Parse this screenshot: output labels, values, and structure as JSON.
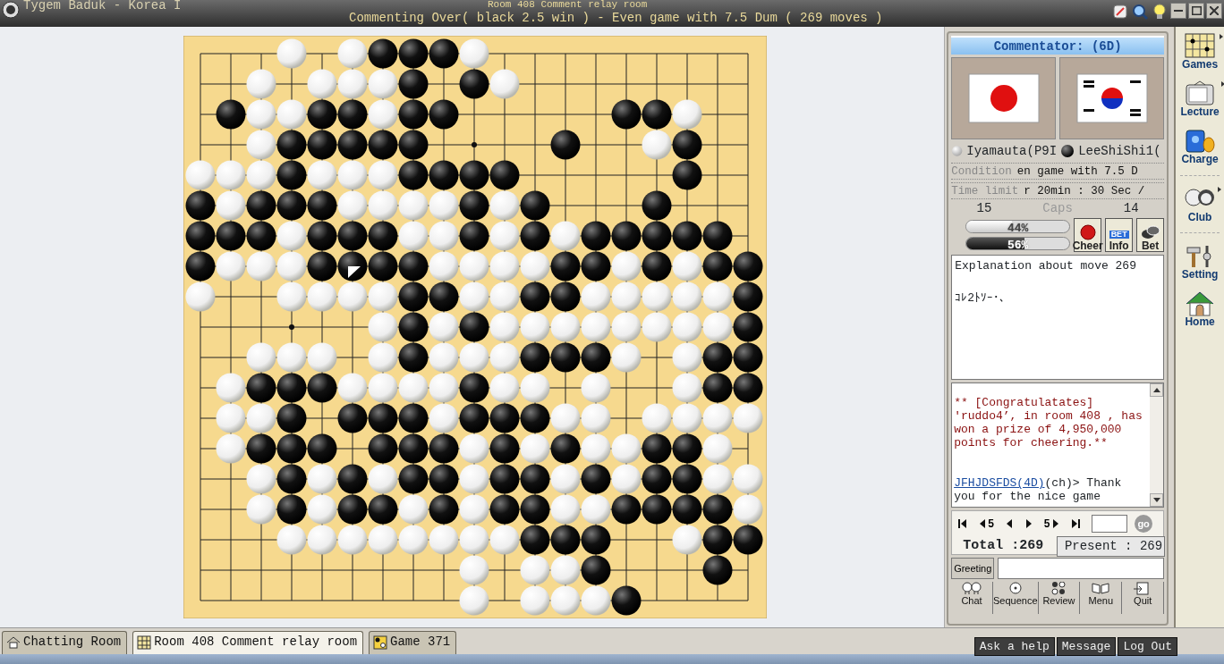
{
  "window": {
    "title": "Tygem Baduk - Korea I",
    "room": "Room 408 Comment relay room",
    "subtitle": "Commenting Over( black 2.5 win ) - Even game with 7.5 Dum  ( 269 moves )"
  },
  "board": {
    "rows": [
      [
        {
          "kind": "empty"
        },
        {
          "kind": "empty"
        },
        {
          "kind": "empty"
        },
        {
          "kind": "white"
        },
        {
          "kind": "empty"
        },
        {
          "kind": "white"
        },
        {
          "kind": "black"
        },
        {
          "kind": "black"
        },
        {
          "kind": "black"
        },
        {
          "kind": "white"
        },
        {
          "kind": "empty"
        },
        {
          "kind": "empty"
        },
        {
          "kind": "empty"
        },
        {
          "kind": "empty"
        },
        {
          "kind": "empty"
        },
        {
          "kind": "empty"
        },
        {
          "kind": "empty"
        },
        {
          "kind": "empty"
        },
        {
          "kind": "empty"
        }
      ],
      [
        {
          "kind": "empty"
        },
        {
          "kind": "empty"
        },
        {
          "kind": "white"
        },
        {
          "kind": "empty"
        },
        {
          "kind": "white"
        },
        {
          "kind": "white"
        },
        {
          "kind": "white"
        },
        {
          "kind": "black"
        },
        {
          "kind": "empty"
        },
        {
          "kind": "black"
        },
        {
          "kind": "white"
        },
        {
          "kind": "empty"
        },
        {
          "kind": "empty"
        },
        {
          "kind": "empty"
        },
        {
          "kind": "empty"
        },
        {
          "kind": "empty"
        },
        {
          "kind": "empty"
        },
        {
          "kind": "empty"
        },
        {
          "kind": "empty"
        }
      ],
      [
        {
          "kind": "empty"
        },
        {
          "kind": "black"
        },
        {
          "kind": "white"
        },
        {
          "kind": "white"
        },
        {
          "kind": "black"
        },
        {
          "kind": "black"
        },
        {
          "kind": "white"
        },
        {
          "kind": "black"
        },
        {
          "kind": "black"
        },
        {
          "kind": "empty"
        },
        {
          "kind": "empty"
        },
        {
          "kind": "empty"
        },
        {
          "kind": "empty"
        },
        {
          "kind": "empty"
        },
        {
          "kind": "black"
        },
        {
          "kind": "black"
        },
        {
          "kind": "white"
        },
        {
          "kind": "empty"
        },
        {
          "kind": "empty"
        }
      ],
      [
        {
          "kind": "empty"
        },
        {
          "kind": "empty"
        },
        {
          "kind": "white"
        },
        {
          "kind": "black"
        },
        {
          "kind": "black"
        },
        {
          "kind": "black"
        },
        {
          "kind": "black"
        },
        {
          "kind": "black"
        },
        {
          "kind": "empty"
        },
        {
          "kind": "empty"
        },
        {
          "kind": "empty"
        },
        {
          "kind": "empty"
        },
        {
          "kind": "black"
        },
        {
          "kind": "empty"
        },
        {
          "kind": "empty"
        },
        {
          "kind": "white"
        },
        {
          "kind": "black"
        },
        {
          "kind": "empty"
        },
        {
          "kind": "empty"
        }
      ],
      [
        {
          "kind": "white"
        },
        {
          "kind": "white"
        },
        {
          "kind": "white"
        },
        {
          "kind": "black"
        },
        {
          "kind": "white"
        },
        {
          "kind": "white"
        },
        {
          "kind": "white"
        },
        {
          "kind": "black"
        },
        {
          "kind": "black"
        },
        {
          "kind": "black"
        },
        {
          "kind": "black"
        },
        {
          "kind": "empty"
        },
        {
          "kind": "empty"
        },
        {
          "kind": "empty"
        },
        {
          "kind": "empty"
        },
        {
          "kind": "empty"
        },
        {
          "kind": "black"
        },
        {
          "kind": "empty"
        },
        {
          "kind": "empty"
        }
      ],
      [
        {
          "kind": "black"
        },
        {
          "kind": "white"
        },
        {
          "kind": "black"
        },
        {
          "kind": "black"
        },
        {
          "kind": "black"
        },
        {
          "kind": "white"
        },
        {
          "kind": "white"
        },
        {
          "kind": "white"
        },
        {
          "kind": "white"
        },
        {
          "kind": "black"
        },
        {
          "kind": "white"
        },
        {
          "kind": "black"
        },
        {
          "kind": "empty"
        },
        {
          "kind": "empty"
        },
        {
          "kind": "empty"
        },
        {
          "kind": "black"
        },
        {
          "kind": "empty"
        },
        {
          "kind": "empty"
        },
        {
          "kind": "empty"
        }
      ],
      [
        {
          "kind": "black"
        },
        {
          "kind": "black"
        },
        {
          "kind": "black"
        },
        {
          "kind": "white"
        },
        {
          "kind": "black"
        },
        {
          "kind": "black"
        },
        {
          "kind": "black"
        },
        {
          "kind": "white"
        },
        {
          "kind": "white"
        },
        {
          "kind": "black"
        },
        {
          "kind": "white"
        },
        {
          "kind": "black"
        },
        {
          "kind": "white"
        },
        {
          "kind": "black"
        },
        {
          "kind": "black"
        },
        {
          "kind": "black"
        },
        {
          "kind": "black"
        },
        {
          "kind": "black"
        },
        {
          "kind": "empty"
        }
      ],
      [
        {
          "kind": "black"
        },
        {
          "kind": "white"
        },
        {
          "kind": "white"
        },
        {
          "kind": "white"
        },
        {
          "kind": "black"
        },
        {
          "kind": "black",
          "last_move": true
        },
        {
          "kind": "black"
        },
        {
          "kind": "black"
        },
        {
          "kind": "white"
        },
        {
          "kind": "white"
        },
        {
          "kind": "white"
        },
        {
          "kind": "white"
        },
        {
          "kind": "black"
        },
        {
          "kind": "black"
        },
        {
          "kind": "white"
        },
        {
          "kind": "black"
        },
        {
          "kind": "white"
        },
        {
          "kind": "black"
        },
        {
          "kind": "black"
        }
      ],
      [
        {
          "kind": "white"
        },
        {
          "kind": "empty"
        },
        {
          "kind": "empty"
        },
        {
          "kind": "white"
        },
        {
          "kind": "white"
        },
        {
          "kind": "white"
        },
        {
          "kind": "white"
        },
        {
          "kind": "black"
        },
        {
          "kind": "black"
        },
        {
          "kind": "white"
        },
        {
          "kind": "white"
        },
        {
          "kind": "black"
        },
        {
          "kind": "black"
        },
        {
          "kind": "white"
        },
        {
          "kind": "white"
        },
        {
          "kind": "white"
        },
        {
          "kind": "white"
        },
        {
          "kind": "white"
        },
        {
          "kind": "black"
        }
      ],
      [
        {
          "kind": "empty"
        },
        {
          "kind": "empty"
        },
        {
          "kind": "empty"
        },
        {
          "kind": "empty"
        },
        {
          "kind": "empty"
        },
        {
          "kind": "empty"
        },
        {
          "kind": "white"
        },
        {
          "kind": "black"
        },
        {
          "kind": "white"
        },
        {
          "kind": "black"
        },
        {
          "kind": "white"
        },
        {
          "kind": "white"
        },
        {
          "kind": "white"
        },
        {
          "kind": "white"
        },
        {
          "kind": "white"
        },
        {
          "kind": "white"
        },
        {
          "kind": "white"
        },
        {
          "kind": "white"
        },
        {
          "kind": "black"
        }
      ],
      [
        {
          "kind": "empty"
        },
        {
          "kind": "empty"
        },
        {
          "kind": "white"
        },
        {
          "kind": "white"
        },
        {
          "kind": "white"
        },
        {
          "kind": "empty"
        },
        {
          "kind": "white"
        },
        {
          "kind": "black"
        },
        {
          "kind": "white"
        },
        {
          "kind": "white"
        },
        {
          "kind": "white"
        },
        {
          "kind": "black"
        },
        {
          "kind": "black"
        },
        {
          "kind": "black"
        },
        {
          "kind": "white"
        },
        {
          "kind": "empty"
        },
        {
          "kind": "white"
        },
        {
          "kind": "black"
        },
        {
          "kind": "black"
        }
      ],
      [
        {
          "kind": "empty"
        },
        {
          "kind": "white"
        },
        {
          "kind": "black"
        },
        {
          "kind": "black"
        },
        {
          "kind": "black"
        },
        {
          "kind": "white"
        },
        {
          "kind": "white"
        },
        {
          "kind": "white"
        },
        {
          "kind": "white"
        },
        {
          "kind": "black"
        },
        {
          "kind": "white"
        },
        {
          "kind": "white"
        },
        {
          "kind": "empty"
        },
        {
          "kind": "white"
        },
        {
          "kind": "empty"
        },
        {
          "kind": "empty"
        },
        {
          "kind": "white"
        },
        {
          "kind": "black"
        },
        {
          "kind": "black"
        }
      ],
      [
        {
          "kind": "empty"
        },
        {
          "kind": "white"
        },
        {
          "kind": "white"
        },
        {
          "kind": "black"
        },
        {
          "kind": "empty"
        },
        {
          "kind": "black"
        },
        {
          "kind": "black"
        },
        {
          "kind": "black"
        },
        {
          "kind": "white"
        },
        {
          "kind": "black"
        },
        {
          "kind": "black"
        },
        {
          "kind": "black"
        },
        {
          "kind": "white"
        },
        {
          "kind": "white"
        },
        {
          "kind": "empty"
        },
        {
          "kind": "white"
        },
        {
          "kind": "white"
        },
        {
          "kind": "white"
        },
        {
          "kind": "white"
        }
      ],
      [
        {
          "kind": "empty"
        },
        {
          "kind": "white"
        },
        {
          "kind": "black"
        },
        {
          "kind": "black"
        },
        {
          "kind": "black"
        },
        {
          "kind": "empty"
        },
        {
          "kind": "black"
        },
        {
          "kind": "black"
        },
        {
          "kind": "black"
        },
        {
          "kind": "white"
        },
        {
          "kind": "black"
        },
        {
          "kind": "white"
        },
        {
          "kind": "black"
        },
        {
          "kind": "white"
        },
        {
          "kind": "white"
        },
        {
          "kind": "black"
        },
        {
          "kind": "black"
        },
        {
          "kind": "white"
        },
        {
          "kind": "empty"
        }
      ],
      [
        {
          "kind": "empty"
        },
        {
          "kind": "empty"
        },
        {
          "kind": "white"
        },
        {
          "kind": "black"
        },
        {
          "kind": "white"
        },
        {
          "kind": "black"
        },
        {
          "kind": "white"
        },
        {
          "kind": "black"
        },
        {
          "kind": "black"
        },
        {
          "kind": "white"
        },
        {
          "kind": "black"
        },
        {
          "kind": "black"
        },
        {
          "kind": "white"
        },
        {
          "kind": "black"
        },
        {
          "kind": "white"
        },
        {
          "kind": "black"
        },
        {
          "kind": "black"
        },
        {
          "kind": "white"
        },
        {
          "kind": "white"
        }
      ],
      [
        {
          "kind": "empty"
        },
        {
          "kind": "empty"
        },
        {
          "kind": "white"
        },
        {
          "kind": "black"
        },
        {
          "kind": "white"
        },
        {
          "kind": "black"
        },
        {
          "kind": "black"
        },
        {
          "kind": "white"
        },
        {
          "kind": "black"
        },
        {
          "kind": "white"
        },
        {
          "kind": "black"
        },
        {
          "kind": "black"
        },
        {
          "kind": "white"
        },
        {
          "kind": "white"
        },
        {
          "kind": "black"
        },
        {
          "kind": "black"
        },
        {
          "kind": "black"
        },
        {
          "kind": "black"
        },
        {
          "kind": "white"
        }
      ],
      [
        {
          "kind": "empty"
        },
        {
          "kind": "empty"
        },
        {
          "kind": "empty"
        },
        {
          "kind": "white"
        },
        {
          "kind": "white"
        },
        {
          "kind": "white"
        },
        {
          "kind": "white"
        },
        {
          "kind": "white"
        },
        {
          "kind": "white"
        },
        {
          "kind": "white"
        },
        {
          "kind": "white"
        },
        {
          "kind": "black"
        },
        {
          "kind": "black"
        },
        {
          "kind": "black"
        },
        {
          "kind": "empty"
        },
        {
          "kind": "empty"
        },
        {
          "kind": "white"
        },
        {
          "kind": "black"
        },
        {
          "kind": "black"
        }
      ],
      [
        {
          "kind": "empty"
        },
        {
          "kind": "empty"
        },
        {
          "kind": "empty"
        },
        {
          "kind": "empty"
        },
        {
          "kind": "empty"
        },
        {
          "kind": "empty"
        },
        {
          "kind": "empty"
        },
        {
          "kind": "empty"
        },
        {
          "kind": "empty"
        },
        {
          "kind": "white"
        },
        {
          "kind": "empty"
        },
        {
          "kind": "white"
        },
        {
          "kind": "white"
        },
        {
          "kind": "black"
        },
        {
          "kind": "empty"
        },
        {
          "kind": "empty"
        },
        {
          "kind": "empty"
        },
        {
          "kind": "black"
        },
        {
          "kind": "empty"
        }
      ],
      [
        {
          "kind": "empty"
        },
        {
          "kind": "empty"
        },
        {
          "kind": "empty"
        },
        {
          "kind": "empty"
        },
        {
          "kind": "empty"
        },
        {
          "kind": "empty"
        },
        {
          "kind": "empty"
        },
        {
          "kind": "empty"
        },
        {
          "kind": "empty"
        },
        {
          "kind": "white"
        },
        {
          "kind": "empty"
        },
        {
          "kind": "white"
        },
        {
          "kind": "white"
        },
        {
          "kind": "white"
        },
        {
          "kind": "black"
        },
        {
          "kind": "empty"
        },
        {
          "kind": "empty"
        },
        {
          "kind": "empty"
        },
        {
          "kind": "empty"
        }
      ]
    ]
  },
  "panel": {
    "commentator": "Commentator: (6D)",
    "players": [
      {
        "name": "Iyamauta(P9I",
        "kind": "white"
      },
      {
        "name": "LeeShiShi1(",
        "kind": "black"
      }
    ],
    "condition": {
      "label": "Condition",
      "value": "en game with 7.5 D"
    },
    "time_limit": {
      "label": "Time limit",
      "value": "r 20min : 30 Sec /"
    },
    "caps": {
      "label": "Caps",
      "white": "15",
      "black": "14"
    },
    "win_bars": [
      {
        "kind": "white",
        "level": 0.44,
        "reading": "44%"
      },
      {
        "kind": "black",
        "level": 0.56,
        "reading": "56%"
      }
    ],
    "actions": [
      {
        "kind": "cheer",
        "label": "Cheer"
      },
      {
        "kind": "info",
        "badge": "BET",
        "label": "Info"
      },
      {
        "kind": "bet",
        "label": "Bet"
      }
    ],
    "explanation": {
      "title": "Explanation about move 269",
      "text": "ｺﾚ2ﾄｿｰ･､"
    },
    "chat": [
      {
        "kind": "notice",
        "text": "** [Congratulatates] 'ruddo4’, in room 408 , has won a prize of 4,950,000 points for cheering.**"
      },
      {
        "kind": "message",
        "user": "JFHJDSFDS(4D)",
        "text": "(ch)> Thank you for the nice game"
      }
    ],
    "navigation": [
      {
        "kind": "first"
      },
      {
        "kind": "back",
        "label": "5"
      },
      {
        "kind": "prev"
      },
      {
        "kind": "next"
      },
      {
        "kind": "forward",
        "label": "5"
      },
      {
        "kind": "last"
      }
    ],
    "go": "go",
    "total": "Total :269",
    "present": "Present : 269",
    "greeting": "Greeting",
    "toolbar": [
      {
        "kind": "chat",
        "label": "Chat"
      },
      {
        "kind": "sequence",
        "label": "Sequence"
      },
      {
        "kind": "review",
        "label": "Review"
      },
      {
        "kind": "menu",
        "label": "Menu"
      },
      {
        "kind": "quit",
        "label": "Quit"
      }
    ]
  },
  "sidebar": [
    {
      "kind": "games",
      "label": "Games",
      "submenu": true
    },
    {
      "kind": "lecture",
      "label": "Lecture",
      "submenu": true
    },
    {
      "kind": "charge",
      "label": "Charge",
      "submenu": false
    },
    {
      "kind": "club",
      "label": "Club",
      "submenu": true
    },
    {
      "kind": "setting",
      "label": "Setting",
      "submenu": false
    },
    {
      "kind": "home",
      "label": "Home",
      "submenu": false
    }
  ],
  "tabs": [
    {
      "kind": "home",
      "label": "Chatting Room",
      "selected": false
    },
    {
      "kind": "board",
      "label": "Room 408 Comment relay room",
      "selected": true
    },
    {
      "kind": "game",
      "label": "Game 371",
      "selected": false
    }
  ],
  "footer_buttons": [
    "Ask a help",
    "Message",
    "Log Out"
  ]
}
